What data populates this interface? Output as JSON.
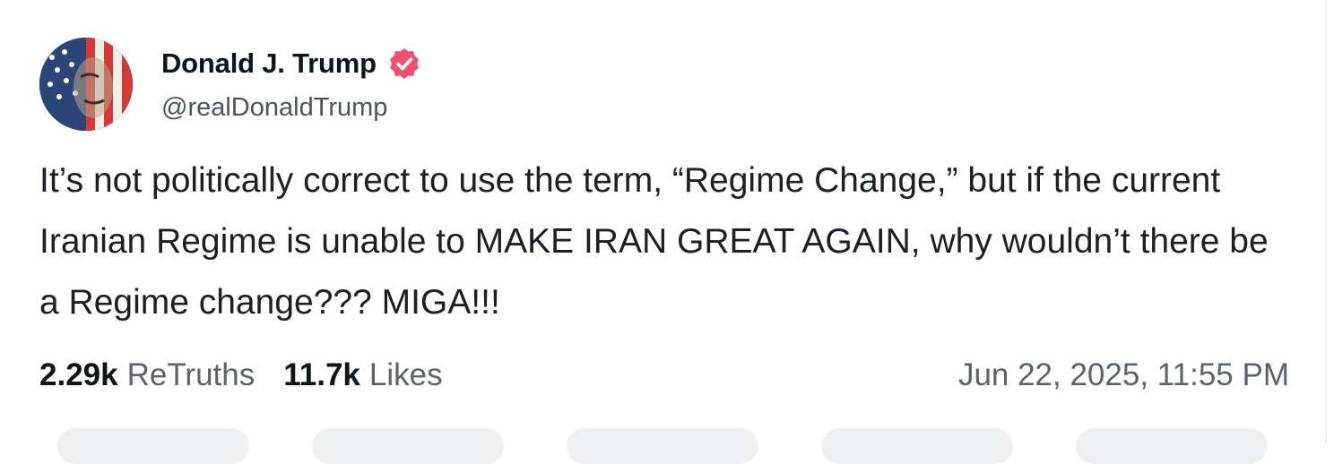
{
  "post": {
    "author": {
      "display_name": "Donald J. Trump",
      "handle": "@realDonaldTrump",
      "verified": true,
      "avatar_icon": "avatar-flag-portrait",
      "verified_icon": "verified-badge-icon",
      "verified_color": "#f0506e"
    },
    "text": "It’s not politically correct to use the term, “Regime Change,” but if the current Iranian Regime is unable to MAKE IRAN GREAT AGAIN, why wouldn’t there be a Regime change??? MIGA!!!",
    "stats": {
      "retruths_count": "2.29k",
      "retruths_label": "ReTruths",
      "likes_count": "11.7k",
      "likes_label": "Likes"
    },
    "timestamp": "Jun 22, 2025, 11:55 PM"
  }
}
